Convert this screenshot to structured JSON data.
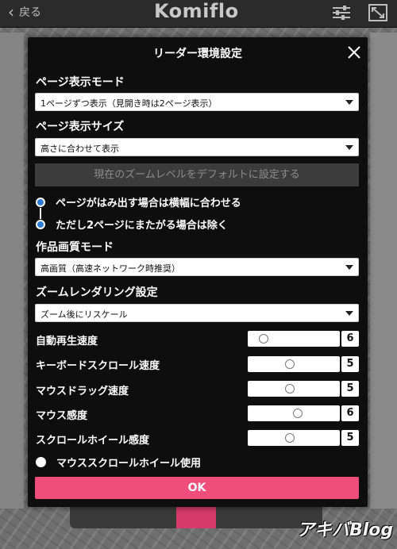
{
  "topbar": {
    "back_label": "戻る",
    "logo": "Komiflo",
    "icons": [
      "back-chevron-icon",
      "settings-sliders-icon",
      "fullscreen-icon"
    ]
  },
  "watermark": "アキバBlog",
  "modal": {
    "title": "リーダー環境設定",
    "page_mode": {
      "label": "ページ表示モード",
      "selected": "1ページずつ表示（見開き時は2ページ表示）"
    },
    "page_size": {
      "label": "ページ表示サイズ",
      "selected": "高さに合わせて表示"
    },
    "default_zoom_button": "現在のズームレベルをデフォルトに設定する",
    "fit_width": {
      "label": "ページがはみ出す場合は横幅に合わせる",
      "except_label": "ただし2ページにまたがる場合は除く"
    },
    "quality": {
      "label": "作品画質モード",
      "selected": "高画質（高速ネットワーク時推奨）"
    },
    "zoom_render": {
      "label": "ズームレンダリング設定",
      "selected": "ズーム後にリスケール"
    },
    "sliders": [
      {
        "label": "自動再生速度",
        "value": "6",
        "level": 0.1
      },
      {
        "label": "キーボードスクロール速度",
        "value": "5",
        "level": 0.45
      },
      {
        "label": "マウスドラッグ速度",
        "value": "5",
        "level": 0.45
      },
      {
        "label": "マウス感度",
        "value": "6",
        "level": 0.55
      },
      {
        "label": "スクロールホイール感度",
        "value": "5",
        "level": 0.45
      }
    ],
    "mouse_wheel": {
      "label": "マウススクロールホイール使用"
    },
    "ok_button": "OK"
  },
  "colors": {
    "accent": "#f04e7a",
    "radio": "#2d7bd6",
    "modal_bg": "#0e0e0e"
  }
}
